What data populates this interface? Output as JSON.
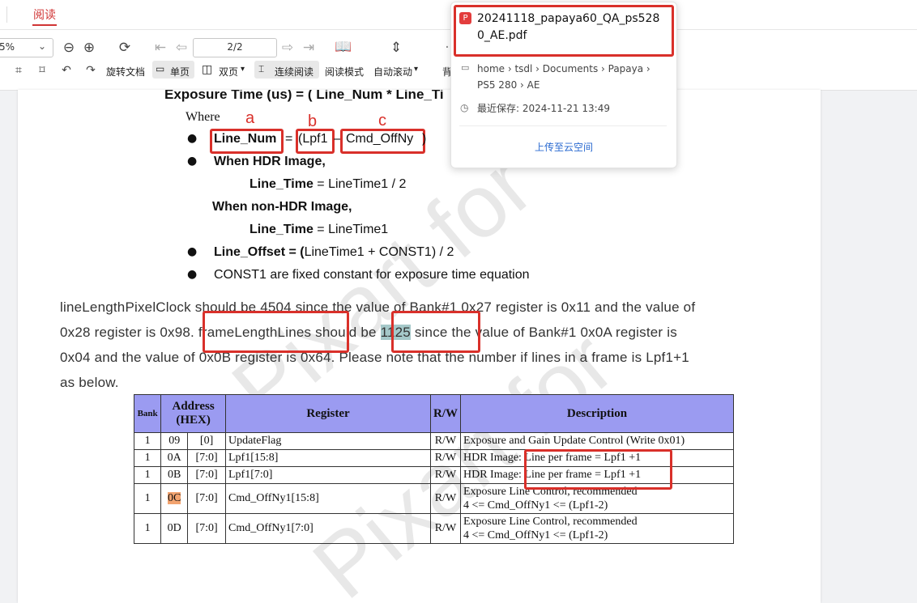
{
  "tabbar": {
    "active_tab": "阅读"
  },
  "toolbar": {
    "zoom_value": "5%",
    "page_value": "2/2",
    "rotate_label": "旋转文档",
    "single_label": "单页",
    "double_label": "双页",
    "continuous_label": "连续阅读",
    "read_mode_label": "阅读模式",
    "auto_scroll_label": "自动滚动",
    "bg_label": "背"
  },
  "document": {
    "formula_line": "Exposure Time (us) = ( Line_Num * Line_Ti",
    "where": "Where",
    "label_a": "a",
    "label_b": "b",
    "label_c": "c",
    "line_num": "Line_Num",
    "equals": "=",
    "lpf1": "(Lpf1",
    "minus": "–",
    "cmd_offny": "Cmd_OffNy",
    "close_paren": ")",
    "hdr_heading": "When HDR Image,",
    "hdr_line_time_bold": "Line_Time",
    "hdr_line_time_rest": " = LineTime1 / 2",
    "nonhdr_heading": "When non-HDR Image,",
    "nonhdr_line_time_bold": "Line_Time",
    "nonhdr_line_time_rest": " = LineTime1",
    "line_offset_bold": "Line_Offset = (",
    "line_offset_rest": "LineTime1 + CONST1) / 2",
    "const1_line": "CONST1 are fixed constant for exposure time equation",
    "para": {
      "line1": "lineLengthPixelClock should be 4504 since the value of Bank#1 0x27 register is 0x11 and the value of",
      "line2_a": "0x28 register is 0x98.  frameLengthLines should be ",
      "line2_hl": "1125",
      "line2_b": " since the value of Bank#1 0x0A register is",
      "line3": "0x04 and the value of 0x0B register is 0x64.  Please note that the number if lines in a frame is Lpf1+1",
      "line4": "as below."
    },
    "table": {
      "headers": [
        "Bank",
        "Address (HEX)",
        "Register",
        "R/W",
        "Description"
      ],
      "rows": [
        {
          "bank": "1",
          "addr": "09",
          "bits": "[0]",
          "reg": "UpdateFlag",
          "rw": "R/W",
          "desc1": "Exposure and Gain Update Control (Write 0x01)",
          "desc2": ""
        },
        {
          "bank": "1",
          "addr": "0A",
          "bits": "[7:0]",
          "reg": "Lpf1[15:8]",
          "rw": "R/W",
          "desc1": "HDR Image: Line per frame = Lpf1 +1",
          "desc2": ""
        },
        {
          "bank": "1",
          "addr": "0B",
          "bits": "[7:0]",
          "reg": "Lpf1[7:0]",
          "rw": "R/W",
          "desc1": "HDR Image: Line per frame = Lpf1 +1",
          "desc2": ""
        },
        {
          "bank": "1",
          "addr": "0C",
          "bits": "[7:0]",
          "reg": "Cmd_OffNy1[15:8]",
          "rw": "R/W",
          "desc1": "Exposure Line Control, recommended",
          "desc2": "4 <= Cmd_OffNy1 <= (Lpf1-2)"
        },
        {
          "bank": "1",
          "addr": "0D",
          "bits": "[7:0]",
          "reg": "Cmd_OffNy1[7:0]",
          "rw": "R/W",
          "desc1": "Exposure Line Control, recommended",
          "desc2": "4 <= Cmd_OffNy1 <= (Lpf1-2)"
        }
      ]
    }
  },
  "popup": {
    "title": "20241118_papaya60_QA_ps5280_AE.pdf",
    "path": "home › tsdl › Documents › Papaya › PS5 280 › AE",
    "last_saved": "最近保存: 2024-11-21 13:49",
    "upload": "上传至云空间"
  },
  "colors": {
    "accent_red": "#d9302a",
    "table_header": "#9b9bf1",
    "highlight": "#a5c8c9",
    "link": "#2a6ad0"
  }
}
